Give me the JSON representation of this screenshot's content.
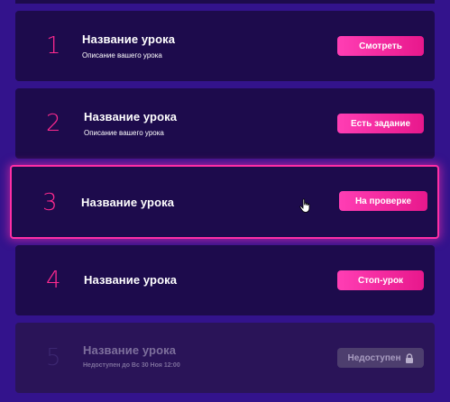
{
  "lessons": [
    {
      "number": "1",
      "title": "Название урока",
      "description": "Описание вашего урока",
      "button": "Смотреть"
    },
    {
      "number": "2",
      "title": "Название урока",
      "description": "Описание вашего урока",
      "button": "Есть задание"
    },
    {
      "number": "3",
      "title": "Название урока",
      "button": "На проверке"
    },
    {
      "number": "4",
      "title": "Название урока",
      "button": "Стоп-урок"
    },
    {
      "number": "5",
      "title": "Название урока",
      "description": "Недоступен до Вс 30 Ноя 12:00",
      "button": "Недоступен"
    }
  ],
  "colors": {
    "background": "#33138c",
    "card": "#1d0b4c",
    "accent": "#ff2a8f",
    "locked_card": "#2a1458"
  },
  "icons": {
    "lock": "lock-icon",
    "cursor": "hand-pointer-icon"
  }
}
